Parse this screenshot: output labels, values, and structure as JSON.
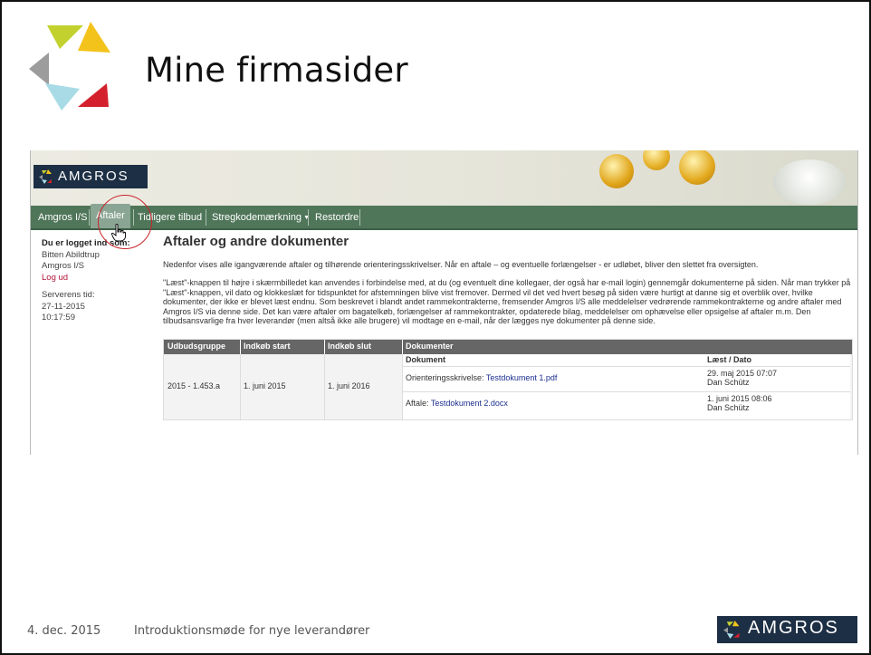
{
  "slide": {
    "title": "Mine firmasider",
    "footer_date": "4. dec. 2015",
    "footer_title": "Introduktionsmøde for nye leverandører",
    "logo_text": "AMGROS"
  },
  "site": {
    "logo_text": "AMGROS",
    "nav": [
      {
        "label": "Amgros I/S"
      },
      {
        "label": "Aftaler"
      },
      {
        "label": "Tidligere tilbud"
      },
      {
        "label": "Stregkodemærkning"
      },
      {
        "label": "Restordre"
      }
    ],
    "sidebar": {
      "logged_in_label": "Du er logget ind som:",
      "user_name": "Bitten Abildtrup",
      "company": "Amgros I/S",
      "logout": "Log ud",
      "server_time_label": "Serverens tid:",
      "server_date": "27-11-2015",
      "server_time": "10:17:59"
    },
    "page_title": "Aftaler og andre dokumenter",
    "intro": "Nedenfor vises alle igangværende aftaler og tilhørende orienteringsskrivelser. Når en aftale – og eventuelle forlængelser - er udløbet, bliver den slettet fra oversigten.",
    "description": "\"Læst\"-knappen til højre i skærmbilledet kan anvendes i forbindelse med, at du (og eventuelt dine kollegaer, der også har e-mail login) gennemgår dokumenterne på siden. Når man trykker på \"Læst\"-knappen, vil dato og klokkeslæt for tidspunktet for afstemningen blive vist fremover. Dermed vil det ved hvert besøg på siden være hurtigt at danne sig et overblik over, hvilke dokumenter, der ikke er blevet læst endnu. Som beskrevet i blandt andet rammekontrakterne, fremsender Amgros I/S alle meddelelser vedrørende rammekontrakterne og andre aftaler med Amgros I/S via denne side. Det kan være aftaler om bagatelkøb, forlængelser af rammekontrakter, opdaterede bilag, meddelelser om ophævelse eller opsigelse af aftaler m.m. Den tilbudsansvarlige fra hver leverandør (men altså ikke alle brugere) vil modtage en e-mail, når der lægges nye dokumenter på denne side.",
    "table": {
      "headers": [
        "Udbudsgruppe",
        "Indkøb start",
        "Indkøb slut",
        "Dokumenter"
      ],
      "sub_headers": {
        "document": "Dokument",
        "read_date": "Læst / Dato"
      },
      "row": {
        "group": "2015 - 1.453.a",
        "start": "1. juni 2015",
        "end": "1. juni 2016",
        "documents": [
          {
            "prefix": "Orienteringsskrivelse:",
            "link": "Testdokument 1.pdf",
            "date": "29. maj 2015 07:07",
            "by": "Dan Schütz"
          },
          {
            "prefix": "Aftale:",
            "link": "Testdokument 2.docx",
            "date": "1. juni 2015 08:06",
            "by": "Dan Schütz"
          }
        ]
      }
    }
  }
}
